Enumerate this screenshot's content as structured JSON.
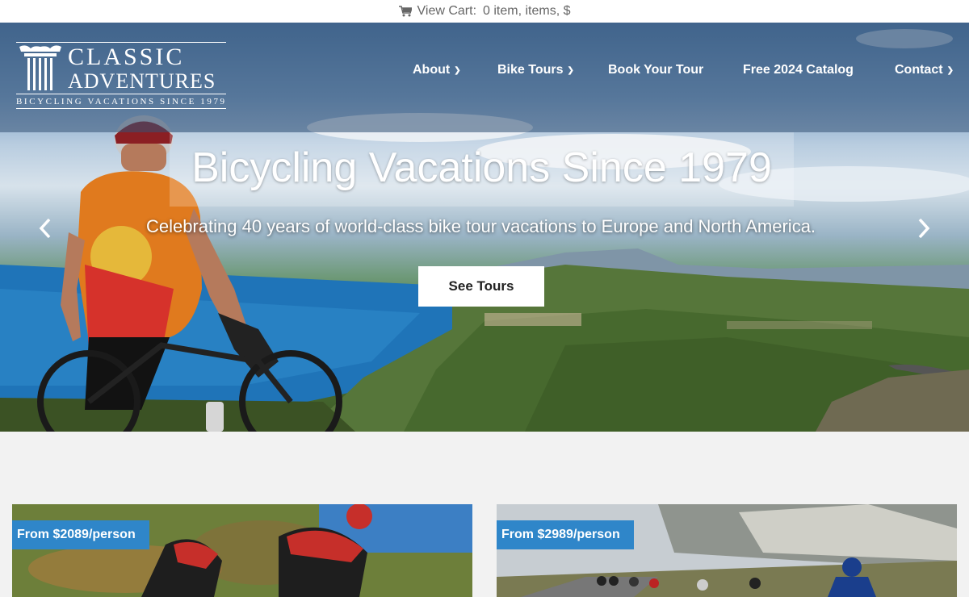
{
  "cart": {
    "icon": "shopping-cart-icon",
    "label": "View Cart:",
    "summary": "0 item, items, $"
  },
  "logo": {
    "line1": "CLASSIC",
    "line2": "ADVENTURES",
    "tagline": "BICYCLING VACATIONS SINCE 1979"
  },
  "nav": {
    "items": [
      {
        "label": "About",
        "has_dropdown": true
      },
      {
        "label": "Bike Tours",
        "has_dropdown": true
      },
      {
        "label": "Book Your Tour",
        "has_dropdown": false
      },
      {
        "label": "Free 2024 Catalog",
        "has_dropdown": false
      },
      {
        "label": "Contact",
        "has_dropdown": true
      }
    ]
  },
  "hero": {
    "title": "Bicycling Vacations Since 1979",
    "subtitle": "Celebrating 40 years of world-class bike tour vacations to Europe and North America.",
    "cta": "See Tours",
    "prev_icon": "chevron-left-icon",
    "next_icon": "chevron-right-icon"
  },
  "cards": [
    {
      "price": "From $2089/person"
    },
    {
      "price": "From $2989/person"
    }
  ],
  "colors": {
    "accent": "#2f86c9",
    "page_bg": "#f2f2f2",
    "header_overlay": "#345276"
  }
}
